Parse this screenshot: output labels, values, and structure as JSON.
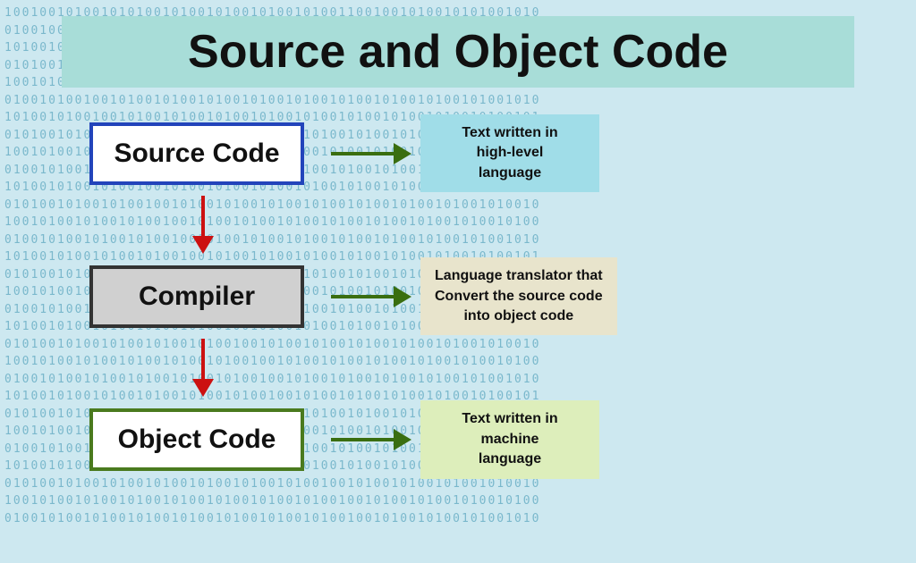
{
  "title": "Source and Object Code",
  "boxes": {
    "source": {
      "label": "Source Code"
    },
    "compiler": {
      "label": "Compiler"
    },
    "object": {
      "label": "Object Code"
    }
  },
  "descriptions": {
    "source": "Text written in\nhigh-level\nlanguage",
    "compiler": "Language translator that\nConvert the source code\ninto object code",
    "object": "Text written in\nmachine\nlanguage"
  },
  "binary_rows": [
    "1001001010010101001010010100101001010011001001010010101001010",
    "0100100101001010101001010010100101010010100101001010010100101",
    "1010010010100101001010010101001010010100101001010100101001010",
    "0101001001010010100101001010010100101001010010101001010010101",
    "1001010010010100101001010010100101001010010100101001010010100",
    "0100101001001010010100101001010010100101001010010100101001010",
    "1010010100100101001010010100101001010010100101001010010100101",
    "0101001010010010100101001010010100101001010010100101001010010",
    "1001010010100100101001010010100101001010010100101001010010100",
    "0100101001010010010100101001010010100101001010010100101001010",
    "1010010100101001001010010100101001010010100101001010010100101",
    "0101001010010100100101001010010100101001010010100101001010010",
    "1001010010100101001001010010100101001010010100101001010010100",
    "0100101001010010100100101001010010100101001010010100101001010",
    "1010010100101001010010010100101001010010100101001010010100101",
    "0101001010010100101001001010010100101001010010100101001010010",
    "1001010010100101001010010010100101001010010100101001010010100",
    "0100101001010010100101001001010010100101001010010100101001010",
    "1010010100101001010010100100101001010010100101001010010100101",
    "0101001010010100101001010010010100101001010010100101001010010",
    "1001010010100101001010010100100101001010010100101001010010100",
    "0100101001010010100101001010010010100101001010010100101001010",
    "1010010100101001010010100101001001010010100101001010010100101",
    "0101001010010100101001010010100100101001010010100101001010010",
    "1001010010100101001010010100101001001010010100101001010010100",
    "0100101001010010100101001010010100100101001010010100101001010",
    "1010010100101001010010100101001010010010100101001010010100101",
    "0101001010010100101001010010100101001001010010100101001010010",
    "1001010010100101001010010100101001010010010100101001010010100",
    "0100101001010010100101001010010100101001001010010100101001010"
  ]
}
